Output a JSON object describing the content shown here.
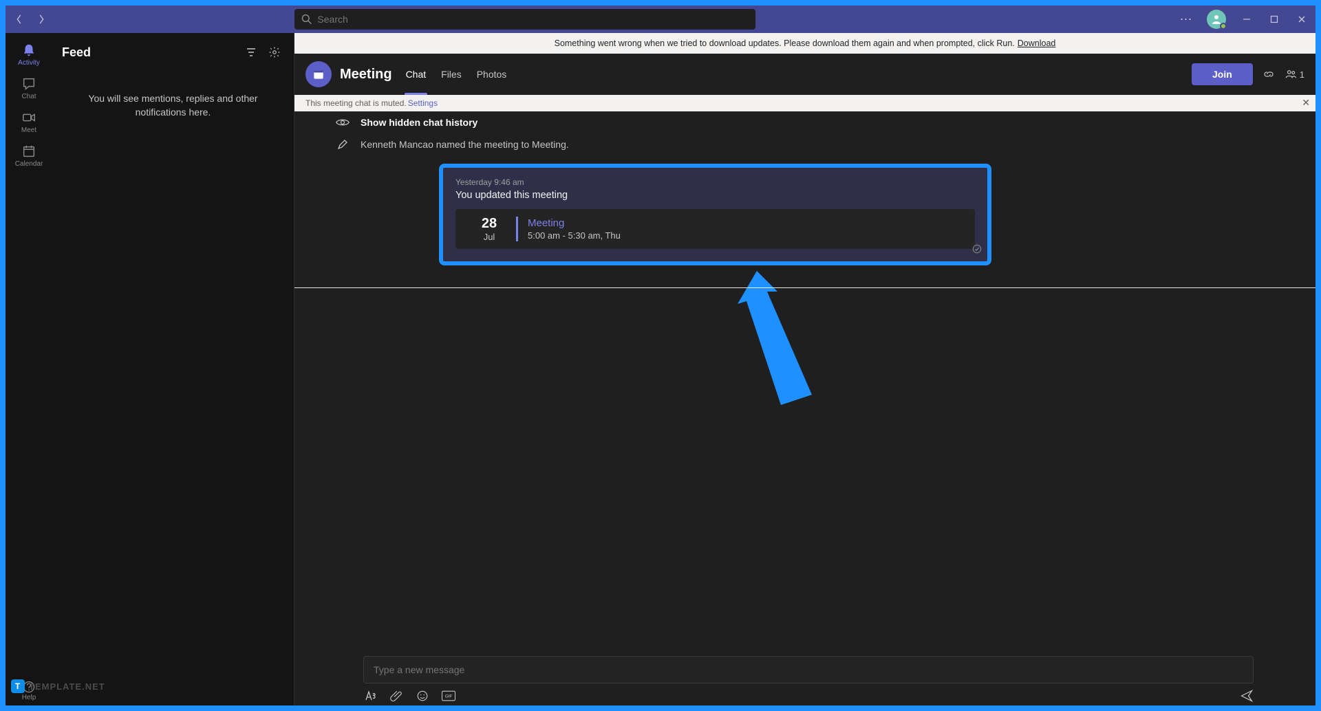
{
  "search": {
    "placeholder": "Search"
  },
  "rail": {
    "items": [
      {
        "label": "Activity"
      },
      {
        "label": "Chat"
      },
      {
        "label": "Meet"
      },
      {
        "label": "Calendar"
      }
    ],
    "help_label": "Help"
  },
  "feed": {
    "title": "Feed",
    "empty_text": "You will see mentions, replies and other notifications here."
  },
  "banner": {
    "text": "Something went wrong when we tried to download updates. Please download them again and when prompted, click Run.",
    "link": "Download"
  },
  "chat_header": {
    "title": "Meeting",
    "tabs": [
      {
        "label": "Chat"
      },
      {
        "label": "Files"
      },
      {
        "label": "Photos"
      }
    ],
    "join_label": "Join",
    "participants_count": "1"
  },
  "muted_banner": {
    "text": "This meeting chat is muted.",
    "link": "Settings"
  },
  "sys_msgs": {
    "show_hidden": "Show hidden chat history",
    "rename": "Kenneth Mancao named the meeting to Meeting."
  },
  "update_card": {
    "timestamp": "Yesterday 9:46 am",
    "message": "You updated this meeting",
    "meeting": {
      "day": "28",
      "month": "Jul",
      "title": "Meeting",
      "time": "5:00 am - 5:30 am, Thu"
    }
  },
  "compose": {
    "placeholder": "Type a new message"
  },
  "watermark": {
    "badge": "T",
    "text": "TEMPLATE.NET"
  }
}
